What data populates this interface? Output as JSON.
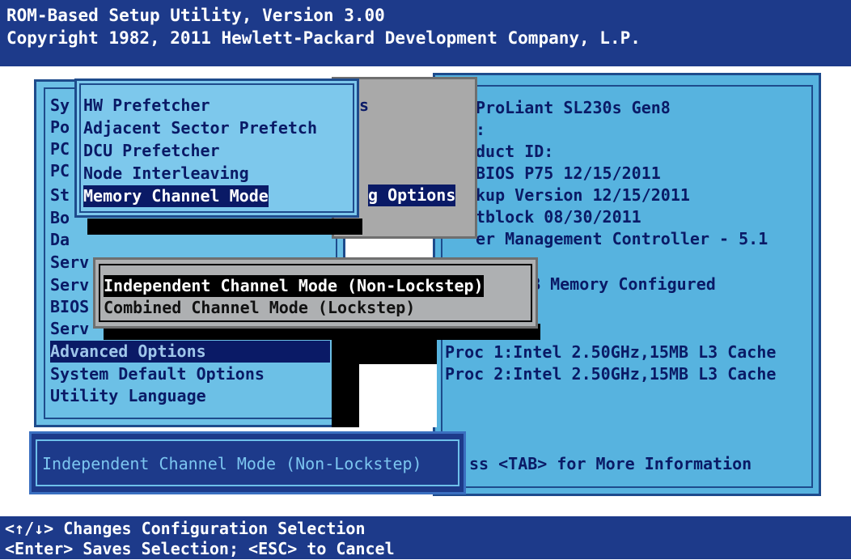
{
  "header": {
    "title": "ROM-Based Setup Utility, Version 3.00",
    "copyright": "Copyright 1982, 2011 Hewlett-Packard Development Company, L.P."
  },
  "main_menu": {
    "items": [
      {
        "label": "Sy"
      },
      {
        "label": "Po"
      },
      {
        "label": "PC"
      },
      {
        "label": "PC"
      },
      {
        "label": "St"
      },
      {
        "label": "Bo"
      },
      {
        "label": "Da"
      },
      {
        "label": "Serv"
      },
      {
        "label": "Serv"
      },
      {
        "label": "BIOS"
      },
      {
        "label": "Serv"
      },
      {
        "label": "Advanced Options"
      },
      {
        "label": "System Default Options"
      },
      {
        "label": "Utility Language"
      }
    ]
  },
  "grey_panel": {
    "fragment_top": "s",
    "fragment_options": "g Options"
  },
  "submenu": {
    "items": [
      {
        "label": "HW Prefetcher"
      },
      {
        "label": "Adjacent Sector Prefetch"
      },
      {
        "label": "DCU Prefetcher"
      },
      {
        "label": "Node Interleaving"
      },
      {
        "label": "Memory Channel Mode"
      }
    ]
  },
  "info": {
    "lines": [
      "ProLiant SL230s Gen8",
      ":",
      "duct ID:",
      "BIOS P75 12/15/2011",
      "kup Version 12/15/2011",
      "tblock 08/30/2011",
      "er Management Controller - 5.1",
      "",
      "B Memory Configured",
      "",
      "",
      "Proc 1:Intel 2.50GHz,15MB L3 Cache",
      "Proc 2:Intel 2.50GHz,15MB L3 Cache"
    ],
    "more_info": "ss <TAB> for More Information"
  },
  "popup": {
    "options": [
      {
        "label": "Independent Channel Mode (Non-Lockstep)"
      },
      {
        "label": "Combined Channel Mode (Lockstep)"
      }
    ]
  },
  "current_value": "Independent Channel Mode (Non-Lockstep)",
  "footer": {
    "line1": "<↑/↓> Changes Configuration Selection",
    "line2": "<Enter> Saves Selection; <ESC> to Cancel"
  },
  "colors": {
    "header_bg": "#1d3a8a",
    "panel_bg": "#6cc0e6",
    "info_bg": "#57b3df",
    "text": "#0a1a66",
    "popup_bg": "#aeb0b2"
  }
}
